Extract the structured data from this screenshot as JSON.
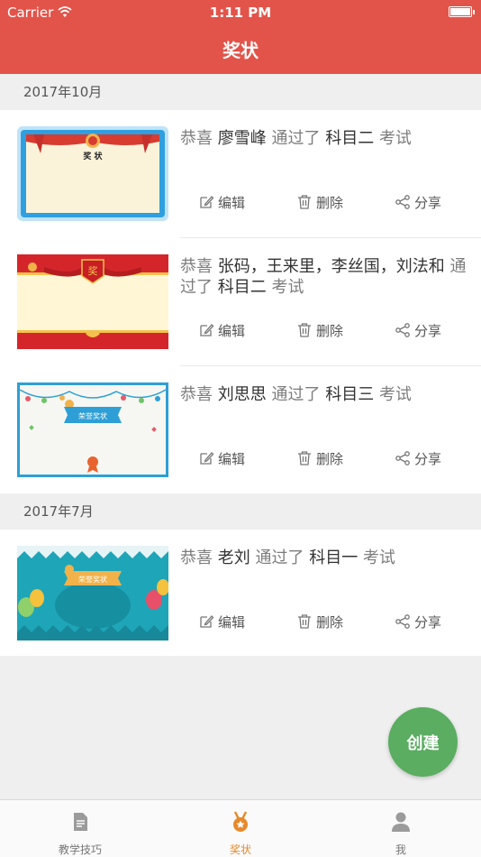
{
  "status_bar": {
    "carrier": "Carrier",
    "time": "1:11 PM"
  },
  "header": {
    "title": "奖状"
  },
  "sections": [
    {
      "date": "2017年10月",
      "items": [
        {
          "prefix": "恭喜",
          "names": "廖雪峰",
          "passed": "通过了",
          "subject": "科目二",
          "suffix": "考试",
          "thumb": "blue-frame-certificate",
          "thumb_text": "奖 状"
        },
        {
          "prefix": "恭喜",
          "names": "张码，王来里，李丝国，刘法和",
          "passed": "通过了",
          "subject": "科目二",
          "suffix": "考试",
          "thumb": "red-banner-certificate",
          "thumb_text": "奖"
        },
        {
          "prefix": "恭喜",
          "names": "刘思思",
          "passed": "通过了",
          "subject": "科目三",
          "suffix": "考试",
          "thumb": "party-bunting-certificate",
          "thumb_text": "荣誉奖状"
        }
      ]
    },
    {
      "date": "2017年7月",
      "items": [
        {
          "prefix": "恭喜",
          "names": "老刘",
          "passed": "通过了",
          "subject": "科目一",
          "suffix": "考试",
          "thumb": "balloon-teal-certificate",
          "thumb_text": "荣誉奖状"
        }
      ]
    }
  ],
  "actions": {
    "edit": "编辑",
    "delete": "删除",
    "share": "分享"
  },
  "fab": {
    "label": "创建"
  },
  "tabbar": [
    {
      "label": "教学技巧",
      "icon": "document-icon",
      "active": false
    },
    {
      "label": "奖状",
      "icon": "medal-icon",
      "active": true
    },
    {
      "label": "我",
      "icon": "person-icon",
      "active": false
    }
  ],
  "colors": {
    "brand_red": "#e2544a",
    "fab_green": "#5aad61",
    "active_tab": "#e8892a"
  }
}
